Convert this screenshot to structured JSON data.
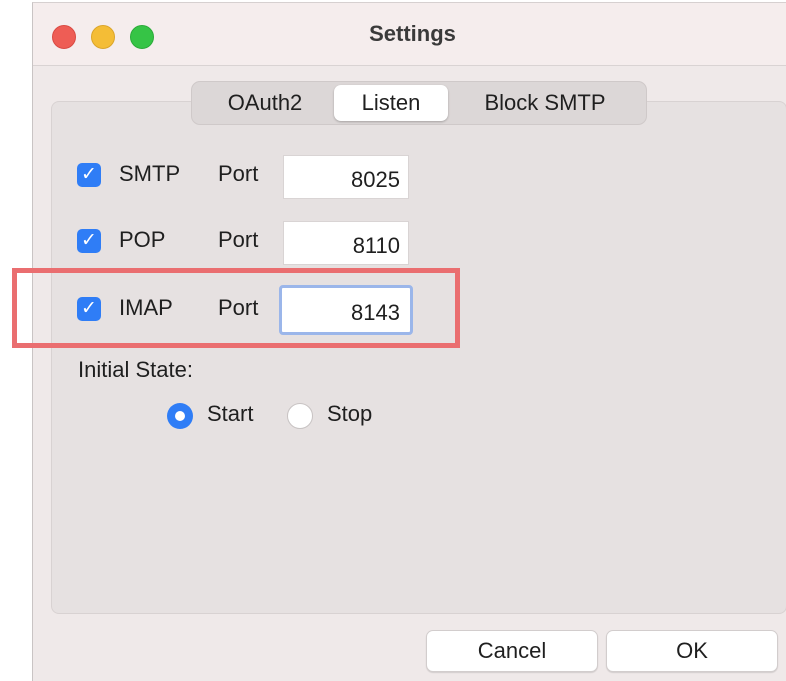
{
  "window": {
    "title": "Settings"
  },
  "tabs": [
    {
      "label": "OAuth2",
      "selected": false
    },
    {
      "label": "Listen",
      "selected": true
    },
    {
      "label": "Block SMTP",
      "selected": false
    }
  ],
  "listen": {
    "rows": [
      {
        "protocol": "SMTP",
        "enabled": true,
        "port_label": "Port",
        "port": "8025"
      },
      {
        "protocol": "POP",
        "enabled": true,
        "port_label": "Port",
        "port": "8110"
      },
      {
        "protocol": "IMAP",
        "enabled": true,
        "port_label": "Port",
        "port": "8143",
        "focused": true
      }
    ],
    "initial_state_label": "Initial State:",
    "initial_state_options": [
      {
        "label": "Start",
        "selected": true
      },
      {
        "label": "Stop",
        "selected": false
      }
    ]
  },
  "buttons": {
    "cancel": "Cancel",
    "ok": "OK"
  },
  "colors": {
    "accent": "#2f7df6",
    "highlight": "#ea6e70",
    "close": "#ee5d55",
    "minimize": "#f4bd36",
    "maximize": "#36c446"
  },
  "icons": {
    "checkbox": "checkmark-icon"
  }
}
